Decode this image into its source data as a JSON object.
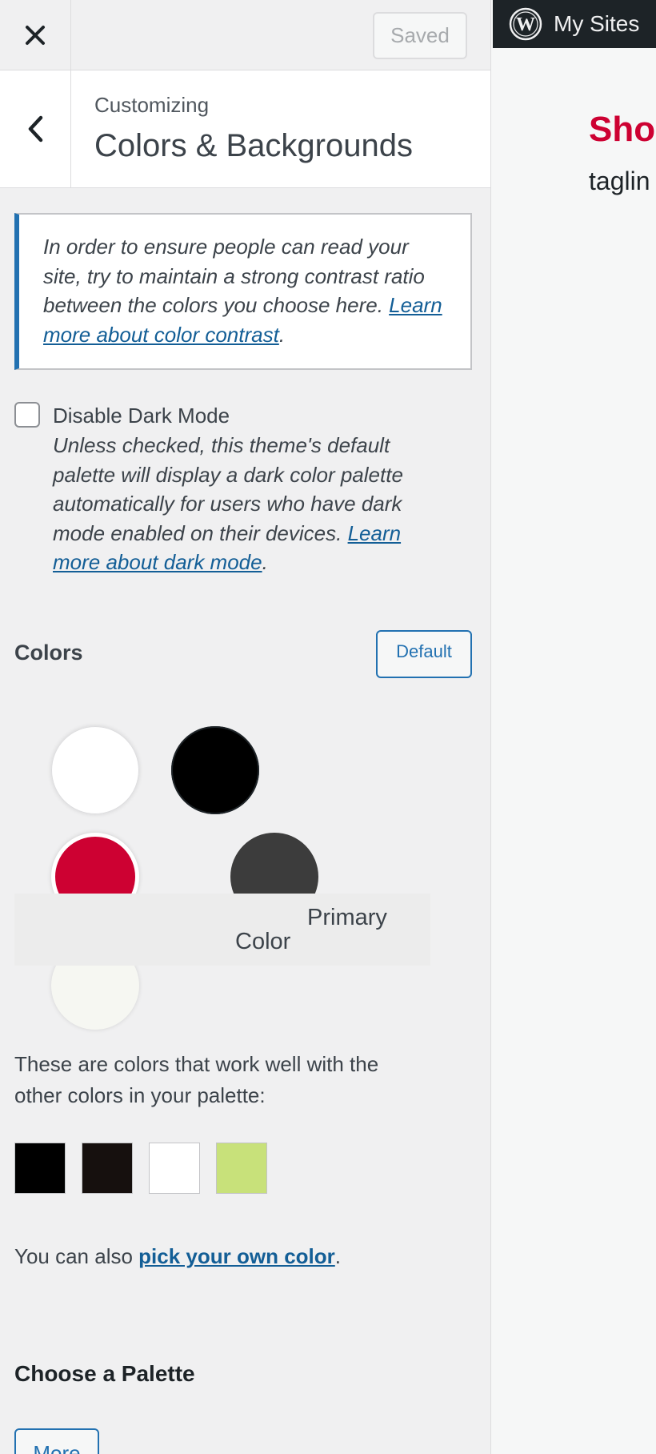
{
  "topbar": {
    "close_icon": "close-icon",
    "saved_label": "Saved"
  },
  "section": {
    "back_icon": "chevron-left-icon",
    "breadcrumb": "Customizing",
    "title": "Colors & Backgrounds"
  },
  "notice": {
    "text": "In order to ensure people can read your site, try to maintain a strong contrast ratio between the colors you choose here. ",
    "link": "Learn more about color contrast",
    "end": "."
  },
  "dark_mode": {
    "label": "Disable Dark Mode",
    "checked": false,
    "description": "Unless checked, this theme's default palette will display a dark color palette automatically for users who have dark mode enabled on their devices. ",
    "link": "Learn more about dark mode",
    "end": "."
  },
  "colors": {
    "heading": "Colors",
    "default_label": "Default",
    "swatches": [
      "#ffffff",
      "#000000",
      "#cd0132",
      "#3c3c3c",
      "#f6f7f2"
    ],
    "tooltip_line1": "Primary",
    "tooltip_line2": "Color"
  },
  "suggestions": {
    "text": "These are colors that work well with the other colors in your palette:",
    "colors": [
      "#000000",
      "#16100e",
      "#ffffff",
      "#c8e17a"
    ]
  },
  "pick_own": {
    "prefix": "You can also ",
    "link": "pick your own color",
    "suffix": "."
  },
  "palette": {
    "heading": "Choose a Palette",
    "more_label": "More"
  },
  "preview": {
    "admin_icon": "wordpress-icon",
    "my_sites_label": "My Sites",
    "site_title": "Shop",
    "tagline": "taglin"
  },
  "accent_color": "#2271b1",
  "brand_red": "#cd0132"
}
